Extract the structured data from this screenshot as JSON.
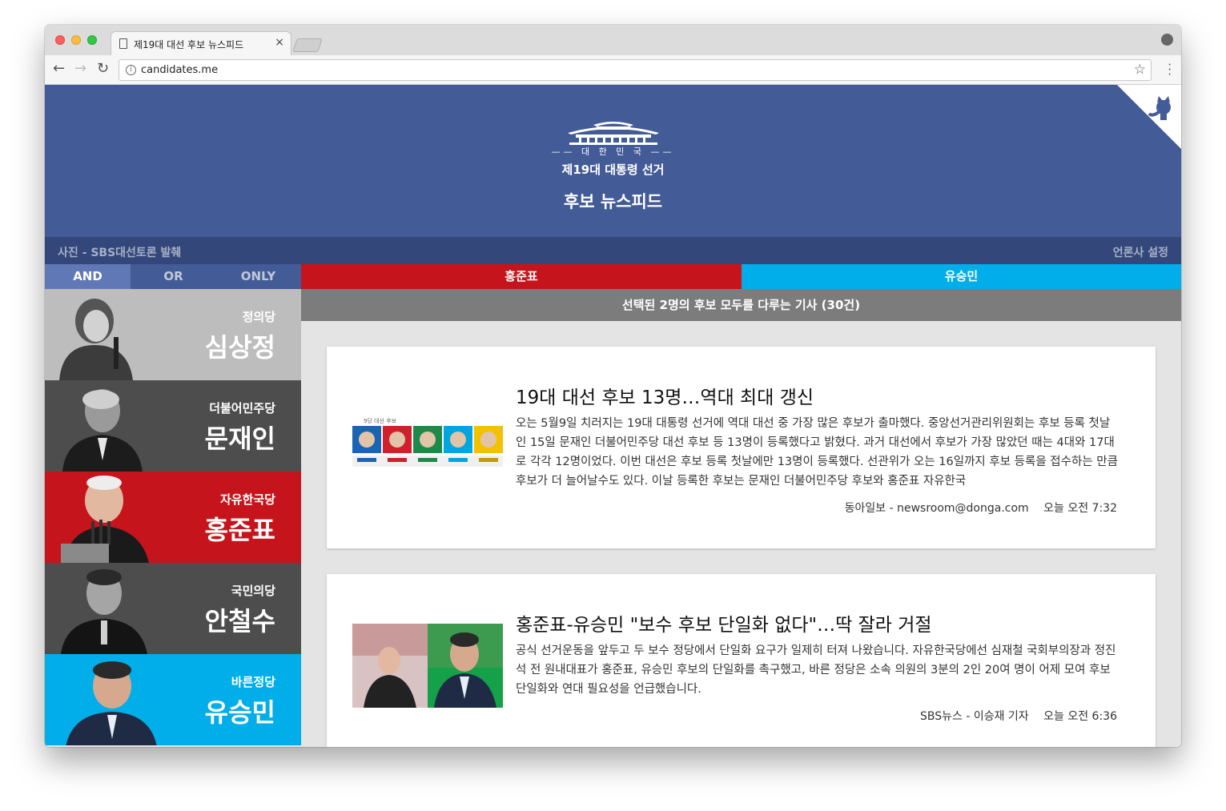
{
  "browser": {
    "tab_title": "제19대 대선 후보 뉴스피드",
    "tab_close": "×",
    "url": "candidates.me"
  },
  "header": {
    "country": "대 한 민 국",
    "election": "제19대 대통령 선거",
    "title": "후보 뉴스피드"
  },
  "subbar": {
    "photo_credit": "사진 - SBS대선토론 발췌",
    "press_settings": "언론사 설정"
  },
  "modes": [
    "AND",
    "OR",
    "ONLY"
  ],
  "active_mode": "AND",
  "selected": [
    {
      "name": "홍준표",
      "color": "#c6141c"
    },
    {
      "name": "유승민",
      "color": "#01aee9"
    }
  ],
  "candidates": [
    {
      "party": "정의당",
      "name": "심상정",
      "bg": "#bdbdbd"
    },
    {
      "party": "더불어민주당",
      "name": "문재인",
      "bg": "#4d4d4d"
    },
    {
      "party": "자유한국당",
      "name": "홍준표",
      "bg": "#c6141c"
    },
    {
      "party": "국민의당",
      "name": "안철수",
      "bg": "#4d4d4d"
    },
    {
      "party": "바른정당",
      "name": "유승민",
      "bg": "#01aee9"
    }
  ],
  "count_text": "선택된 2명의 후보 모두를 다루는 기사 (30건)",
  "articles": [
    {
      "headline": "19대 대선 후보 13명…역대 최대 갱신",
      "summary": "오는 5월9일 치러지는 19대 대통령 선거에 역대 대선 중 가장 많은 후보가 출마했다. 중앙선거관리위원회는 후보 등록 첫날인 15일 문재인 더불어민주당 대선 후보 등 13명이 등록했다고 밝혔다. 과거 대선에서 후보가 가장 많았던 때는 4대와 17대로 각각 12명이었다. 이번 대선은 후보 등록 첫날에만 13명이 등록했다. 선관위가 오는 16일까지 후보 등록을 접수하는 만큼 후보가 더 늘어날수도 있다. 이날 등록한 후보는 문재인 더불어민주당 후보와 홍준표 자유한국",
      "source": "동아일보 - newsroom@donga.com",
      "time": "오늘 오전 7:32",
      "thumb_label": "9당 대선 후보"
    },
    {
      "headline": "홍준표-유승민 \"보수 후보 단일화 없다\"…딱 잘라 거절",
      "summary": "공식 선거운동을 앞두고 두 보수 정당에서 단일화 요구가 일제히 터져 나왔습니다. 자유한국당에선 심재철 국회부의장과 정진석 전 원내대표가 홍준표, 유승민 후보의 단일화를 촉구했고, 바른 정당은 소속 의원의 3분의 2인 20여 명이 어제 모여 후보 단일화와 연대 필요성을 언급했습니다.",
      "source": "SBS뉴스 - 이승재 기자",
      "time": "오늘 오전 6:36"
    }
  ]
}
